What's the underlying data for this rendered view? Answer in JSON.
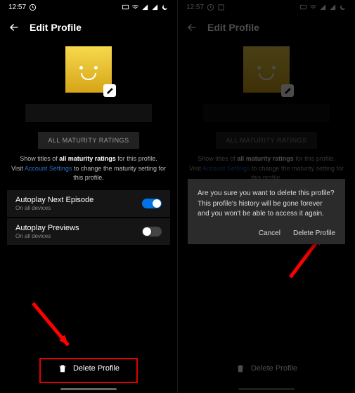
{
  "status": {
    "time": "12:57",
    "icons": [
      "clock-icon",
      "album-icon",
      "cast-icon",
      "wifi-icon",
      "signal-icon",
      "signal-icon",
      "moon-icon"
    ]
  },
  "header": {
    "title": "Edit Profile"
  },
  "profile": {
    "avatar_icon": "smiley",
    "edit_icon": "pencil-icon",
    "name_value": ""
  },
  "maturity": {
    "button_label": "ALL MATURITY RATINGS",
    "desc_prefix": "Show titles of ",
    "desc_bold": "all maturity ratings",
    "desc_suffix": " for this profile.",
    "line2_prefix": "Visit ",
    "link_text": "Account Settings",
    "line2_suffix": " to change the maturity setting for this profile."
  },
  "settings": [
    {
      "title": "Autoplay Next Episode",
      "sub": "On all devices",
      "on": true
    },
    {
      "title": "Autoplay Previews",
      "sub": "On all devices",
      "on": false
    }
  ],
  "delete_label": "Delete Profile",
  "dialog": {
    "message": "Are you sure you want to delete this profile? This profile's history will be gone forever and you won't be able to access it again.",
    "cancel": "Cancel",
    "confirm": "Delete Profile"
  },
  "annotations": {
    "arrow_color": "#ff0000",
    "box_color": "#e40000"
  }
}
